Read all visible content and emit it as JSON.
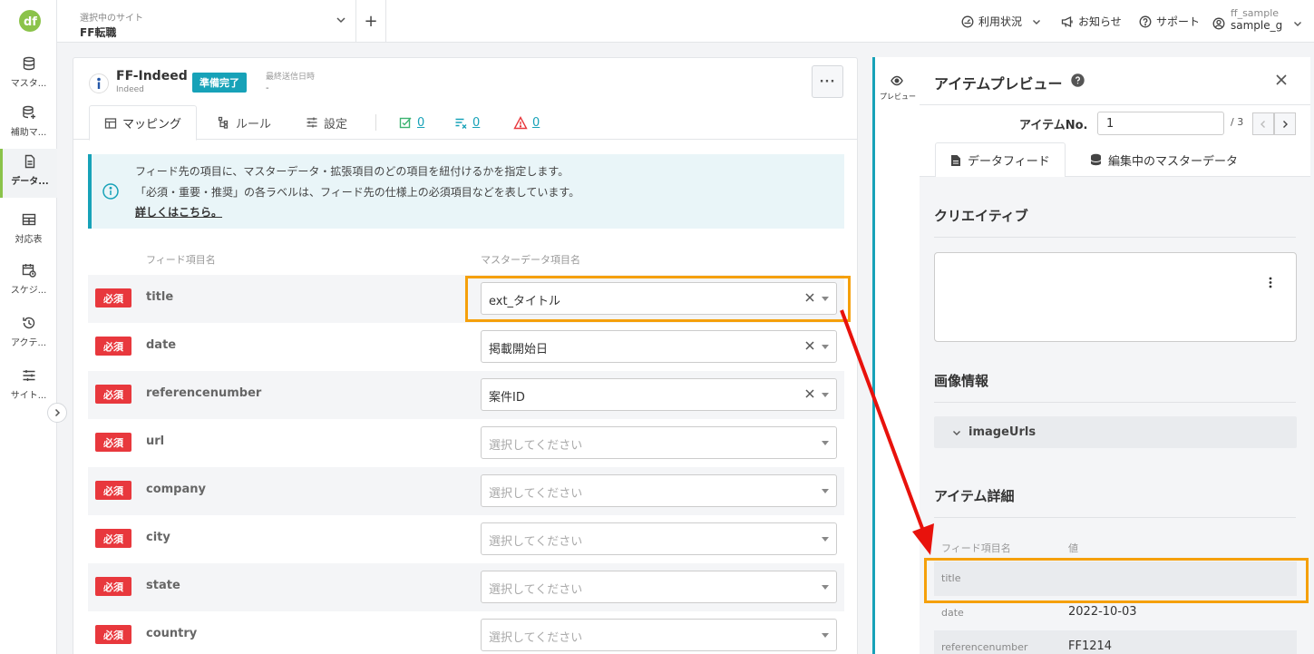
{
  "colors": {
    "accent": "#17a2b8",
    "brand": "#8bc34a",
    "required": "#e8383d",
    "highlight": "#f5a00b",
    "arrow": "#e8120c"
  },
  "sidebar": {
    "items": [
      {
        "label": "マスタ...",
        "icon": "database-icon"
      },
      {
        "label": "補助マ...",
        "icon": "database-plus-icon"
      },
      {
        "label": "データ...",
        "icon": "document-icon",
        "active": true
      },
      {
        "label": "対応表",
        "icon": "table-icon"
      },
      {
        "label": "スケジ...",
        "icon": "calendar-clock-icon"
      },
      {
        "label": "アクテ...",
        "icon": "history-icon"
      },
      {
        "label": "サイト...",
        "icon": "sliders-icon"
      }
    ]
  },
  "header": {
    "site_caption": "選択中のサイト",
    "site_name": "FF転職",
    "add_label": "+",
    "usage": "利用状況",
    "news": "お知らせ",
    "support": "サポート",
    "user_line1": "ff_sample",
    "user_line2": "sample_g"
  },
  "feed": {
    "name": "FF-Indeed",
    "sub": "Indeed",
    "status": "準備完了",
    "last_sent_label": "最終送信日時",
    "last_sent_value": "-",
    "more_label": "···"
  },
  "tabs": {
    "mapping": "マッピング",
    "rule": "ルール",
    "settings": "設定",
    "ok_count": "0",
    "skip_count": "0",
    "warn_count": "0"
  },
  "notice": {
    "line1": "フィード先の項目に、マスターデータ・拡張項目のどの項目を紐付けるかを指定します。",
    "line2": "「必須・重要・推奨」の各ラベルは、フィード先の仕様上の必須項目などを表しています。",
    "link": "詳しくはこちら。"
  },
  "mapping": {
    "col_feed": "フィード項目名",
    "col_master": "マスターデータ項目名",
    "placeholder": "選択してください",
    "rows": [
      {
        "badge": "必須",
        "field": "title",
        "value": "ext_タイトル"
      },
      {
        "badge": "必須",
        "field": "date",
        "value": "掲載開始日"
      },
      {
        "badge": "必須",
        "field": "referencenumber",
        "value": "案件ID"
      },
      {
        "badge": "必須",
        "field": "url",
        "value": ""
      },
      {
        "badge": "必須",
        "field": "company",
        "value": ""
      },
      {
        "badge": "必須",
        "field": "city",
        "value": ""
      },
      {
        "badge": "必須",
        "field": "state",
        "value": ""
      },
      {
        "badge": "必須",
        "field": "country",
        "value": ""
      }
    ]
  },
  "rail": {
    "label": "プレビュー"
  },
  "preview": {
    "title": "アイテムプレビュー",
    "item_no_label": "アイテムNo.",
    "item_no_value": "1",
    "item_total": "/ 3",
    "tab_feed": "データフィード",
    "tab_master": "編集中のマスターデータ",
    "creative_title": "クリエイティブ",
    "image_title": "画像情報",
    "image_urls": "imageUrls",
    "detail_title": "アイテム詳細",
    "col_field": "フィード項目名",
    "col_value": "値",
    "rows": [
      {
        "k": "title",
        "v": ""
      },
      {
        "k": "date",
        "v": "2022-10-03"
      },
      {
        "k": "referencenumber",
        "v": "FF1214"
      }
    ]
  }
}
